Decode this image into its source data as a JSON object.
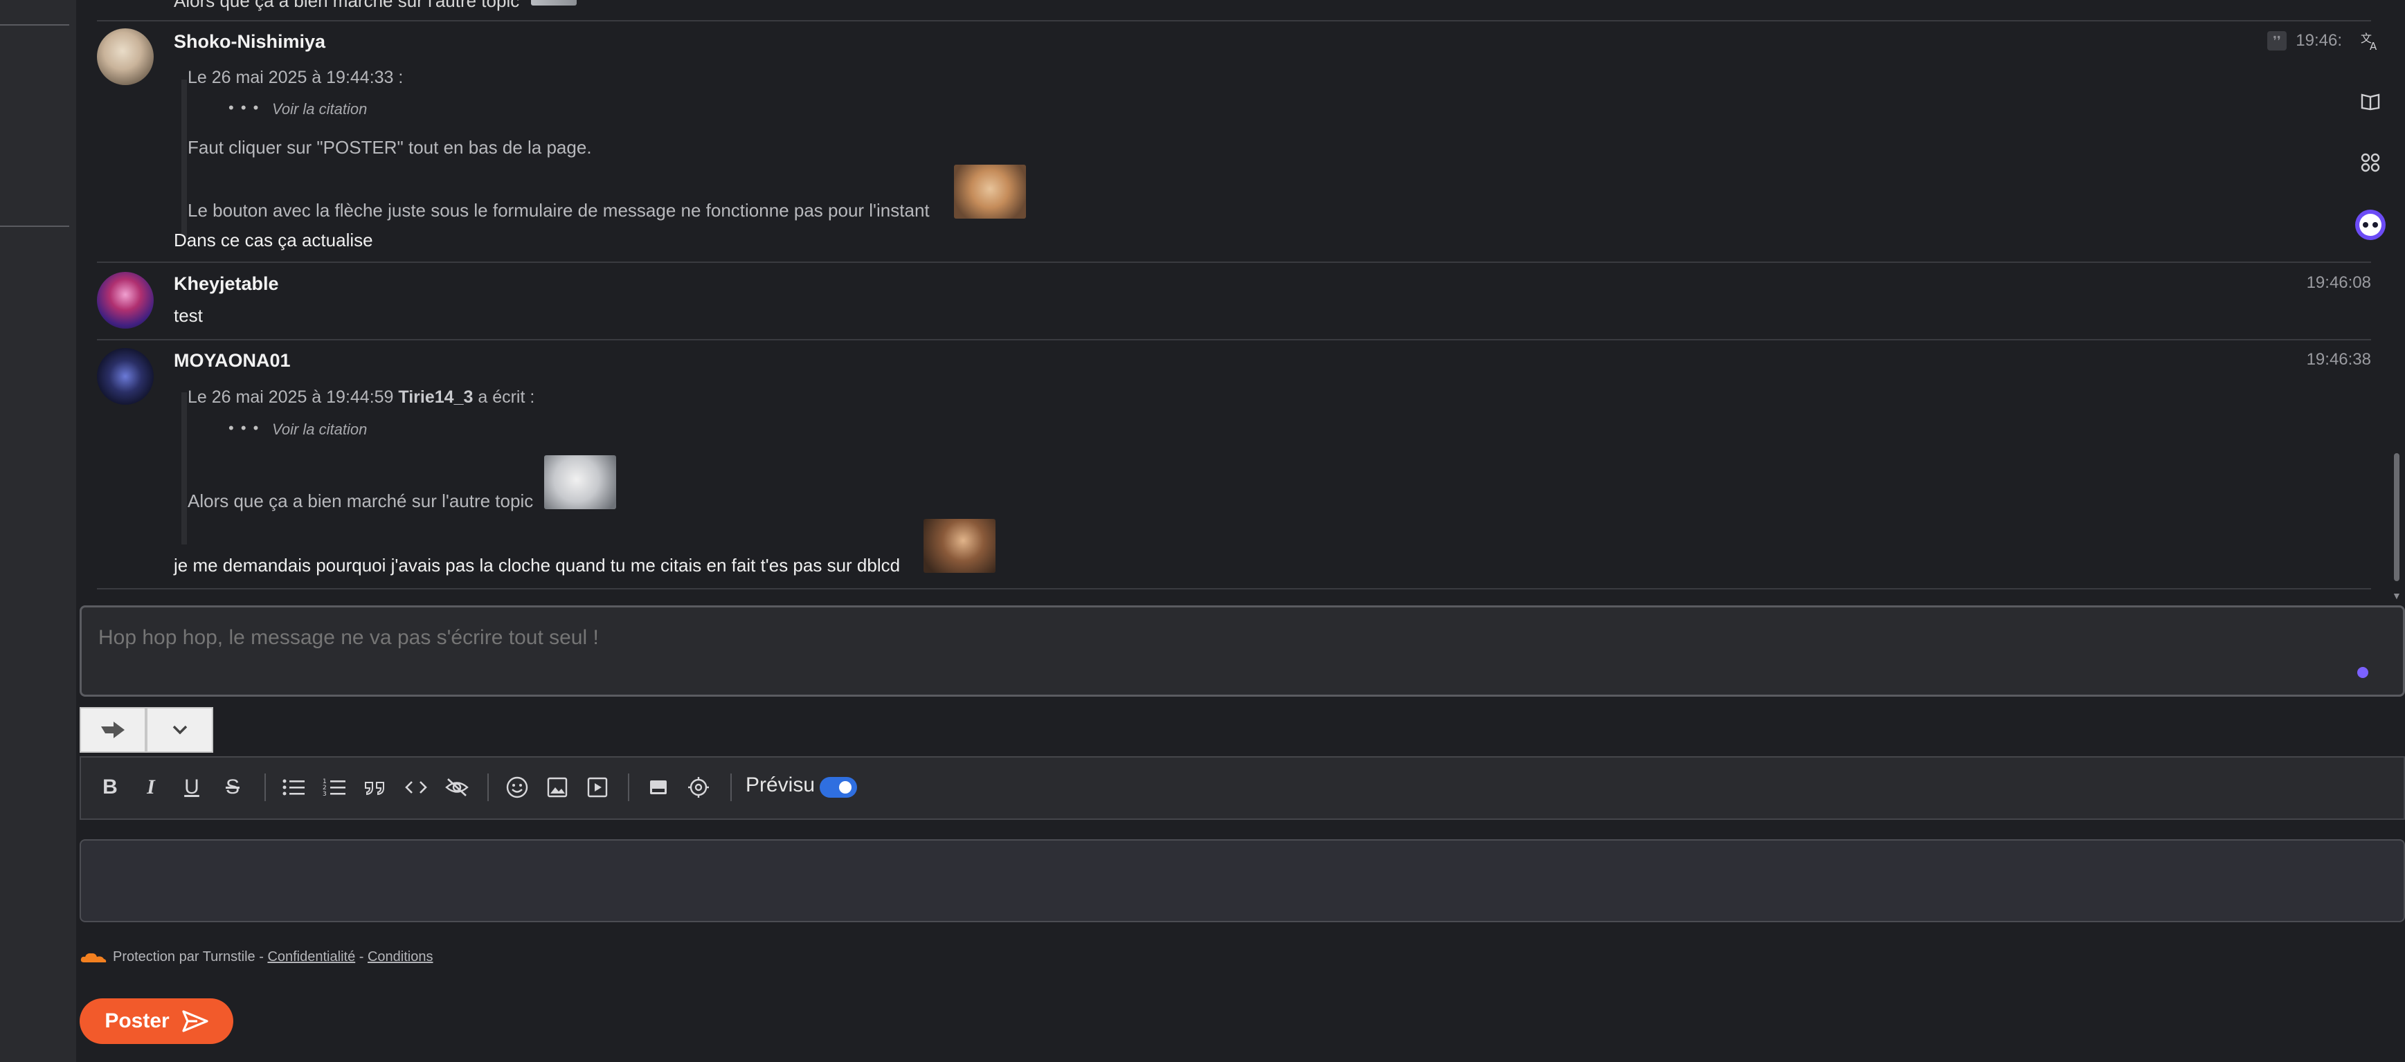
{
  "messages": [
    {
      "author": "",
      "partial_text": "Alors que ça a bien marché sur l'autre topic"
    },
    {
      "author": "Shoko-Nishimiya",
      "time": "19:46:",
      "quote_header": "Le 26 mai 2025 à 19:44:33 :",
      "see_quote": "Voir la citation",
      "quote_lines": [
        "Faut cliquer sur \"POSTER\" tout en bas de la page.",
        "Le bouton avec la flèche juste sous le formulaire de message ne fonctionne pas pour l'instant"
      ],
      "text": "Dans ce cas ça actualise"
    },
    {
      "author": "Kheyjetable",
      "time": "19:46:08",
      "text": "test"
    },
    {
      "author": "MOYAONA01",
      "time": "19:46:38",
      "quote_header_prefix": "Le 26 mai 2025 à 19:44:59",
      "quote_author": "Tirie14_3",
      "quote_header_suffix": "a écrit :",
      "see_quote": "Voir la citation",
      "quote_lines": [
        "Alors que ça a bien marché sur l'autre topic"
      ],
      "text": "je me demandais pourquoi j'avais pas la cloche quand tu me citais en fait t'es pas sur dblcd"
    }
  ],
  "composer": {
    "placeholder": "Hop hop hop, le message ne va pas s'écrire tout seul !"
  },
  "toolbar": {
    "bold": "B",
    "italic": "I",
    "underline": "U",
    "strike": "S",
    "preview_label": "Prévisu",
    "preview_enabled": true
  },
  "footer": {
    "protection": "Protection par Turnstile -",
    "privacy": "Confidentialité",
    "separator": "-",
    "terms": "Conditions",
    "post_label": "Poster"
  },
  "colors": {
    "accent_orange": "#f25a2b",
    "toggle_blue": "#2f6fe0",
    "background": "#1e1f23"
  },
  "icons": [
    "translate-icon",
    "book-icon",
    "apps-icon",
    "assistant-icon"
  ]
}
